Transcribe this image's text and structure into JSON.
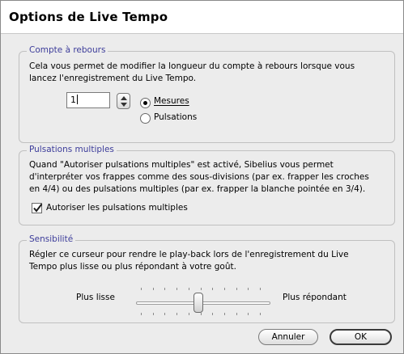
{
  "window": {
    "title": "Options de Live Tempo"
  },
  "countdown": {
    "legend": "Compte à rebours",
    "description_lines": [
      "Cela vous permet de modifier la longueur du compte à rebours lorsque vous",
      "lancez l'enregistrement du Live Tempo."
    ],
    "value": "1",
    "options": [
      {
        "label": "Mesures",
        "selected": true
      },
      {
        "label": "Pulsations",
        "selected": false
      }
    ]
  },
  "multiple_beats": {
    "legend": "Pulsations multiples",
    "description_lines": [
      "Quand \"Autoriser pulsations multiples\" est activé, Sibelius vous permet",
      "d'interpréter vos frappes comme des sous-divisions (par ex. frapper les croches",
      "en 4/4) ou des pulsations multiples (par ex. frapper la blanche pointée en 3/4)."
    ],
    "checkbox_label": "Autoriser les pulsations multiples",
    "checked": true
  },
  "sensitivity": {
    "legend": "Sensibilité",
    "description_lines": [
      "Régler ce curseur pour rendre le play-back lors de l'enregistrement du Live",
      "Tempo plus lisse ou plus répondant à votre goût."
    ],
    "left_label": "Plus lisse",
    "right_label": "Plus répondant",
    "slider_value": 0.5
  },
  "buttons": {
    "cancel": "Annuler",
    "ok": "OK"
  }
}
